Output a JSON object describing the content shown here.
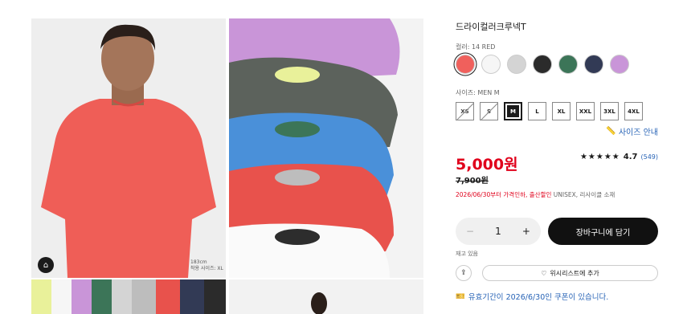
{
  "product": {
    "title": "드라이컬러크루넥T",
    "color_label": "컬러: 14 RED",
    "colors": [
      "#f0605c",
      "#f6f6f6",
      "#d4d4d4",
      "#2b2b2b",
      "#3c7558",
      "#323a55",
      "#c995d8"
    ],
    "selected_color_index": 0,
    "size_label": "사이즈: MEN M",
    "sizes": [
      {
        "label": "XS",
        "state": "disabled"
      },
      {
        "label": "S",
        "state": "disabled"
      },
      {
        "label": "M",
        "state": "selected"
      },
      {
        "label": "L",
        "state": "available"
      },
      {
        "label": "XL",
        "state": "available"
      },
      {
        "label": "XXL",
        "state": "available"
      },
      {
        "label": "3XL",
        "state": "available"
      },
      {
        "label": "4XL",
        "state": "available"
      }
    ],
    "size_guide": "사이즈 안내",
    "price": "5,000원",
    "original_price": "7,900원",
    "rating_stars": "★★★★★",
    "rating": "4.7",
    "review_count": "(549)",
    "promo_red": "2026/06/30부터 가격인하, 출산할인",
    "promo_rest": " UNISEX, 리사이클 소재",
    "quantity": "1",
    "add_to_cart": "장바구니에 담기",
    "stock": "재고 있음",
    "wishlist": "위시리스트에 추가",
    "coupon": "유효기간이 2026/6/30인 쿠폰이 있습니다.",
    "model_caption_1": "183cm",
    "model_caption_2": "착용 사이즈: XL"
  },
  "colors_ui": {
    "red": "#e0001b",
    "link": "#2763b6",
    "dark": "#111111"
  }
}
